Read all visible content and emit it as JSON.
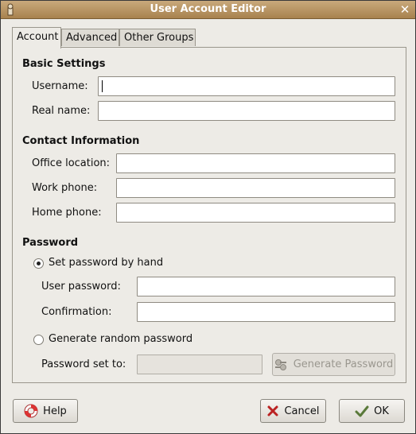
{
  "window": {
    "title": "User Account Editor"
  },
  "tabs": [
    {
      "label": "Account",
      "active": true
    },
    {
      "label": "Advanced",
      "active": false
    },
    {
      "label": "Other Groups",
      "active": false
    }
  ],
  "basic": {
    "title": "Basic Settings",
    "username_label": "Username:",
    "username_value": "",
    "realname_label": "Real name:",
    "realname_value": ""
  },
  "contact": {
    "title": "Contact Information",
    "office_label": "Office location:",
    "work_label": "Work phone:",
    "home_label": "Home phone:"
  },
  "password": {
    "title": "Password",
    "by_hand_label": "Set password by hand",
    "by_hand_selected": true,
    "user_password_label": "User password:",
    "confirmation_label": "Confirmation:",
    "random_label": "Generate random password",
    "random_selected": false,
    "set_to_label": "Password set to:",
    "generate_button": "Generate Password"
  },
  "buttons": {
    "help": "Help",
    "cancel": "Cancel",
    "ok": "OK"
  },
  "icons": {
    "help": "help-lifebuoy-icon",
    "cancel": "cancel-x-icon",
    "ok": "ok-hand-icon",
    "generate": "keys-icon",
    "close": "close-icon",
    "app": "app-icon"
  }
}
